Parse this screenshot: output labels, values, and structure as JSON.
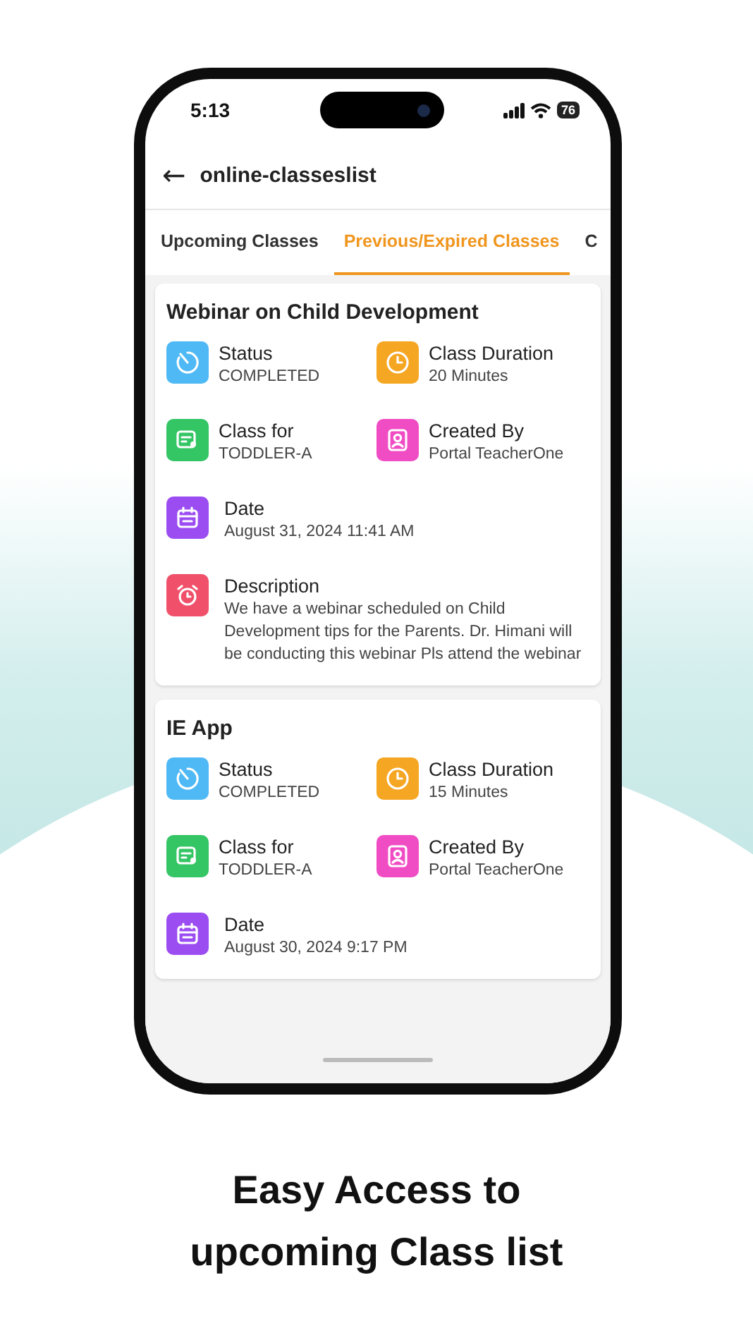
{
  "status_bar": {
    "time": "5:13",
    "battery": "76"
  },
  "header": {
    "back_icon": "←",
    "title": "online-classeslist"
  },
  "tabs": [
    {
      "label": "Upcoming Classes",
      "selected": false
    },
    {
      "label": "Previous/Expired Classes",
      "selected": true
    },
    {
      "label": "C",
      "selected": false
    }
  ],
  "classes": [
    {
      "title": "Webinar on Child Development",
      "fields": [
        {
          "kind": "status",
          "label": "Status",
          "value": "COMPLETED"
        },
        {
          "kind": "duration",
          "label": "Class Duration",
          "value": "20 Minutes"
        },
        {
          "kind": "class_for",
          "label": "Class for",
          "value": "TODDLER-A"
        },
        {
          "kind": "created_by",
          "label": "Created By",
          "value": "Portal TeacherOne"
        },
        {
          "kind": "date",
          "label": "Date",
          "value": "August 31, 2024 11:41 AM"
        },
        {
          "kind": "description",
          "label": "Description",
          "value": "We have a webinar scheduled on Child Development tips for the Parents. Dr. Himani will be conducting this webinar Pls attend the webinar"
        }
      ]
    },
    {
      "title": "IE App",
      "fields": [
        {
          "kind": "status",
          "label": "Status",
          "value": "COMPLETED"
        },
        {
          "kind": "duration",
          "label": "Class Duration",
          "value": "15 Minutes"
        },
        {
          "kind": "class_for",
          "label": "Class for",
          "value": "TODDLER-A"
        },
        {
          "kind": "created_by",
          "label": "Created By",
          "value": "Portal TeacherOne"
        },
        {
          "kind": "date",
          "label": "Date",
          "value": "August 30, 2024 9:17 PM"
        }
      ]
    }
  ],
  "caption": [
    "Easy Access to",
    "upcoming Class list"
  ]
}
